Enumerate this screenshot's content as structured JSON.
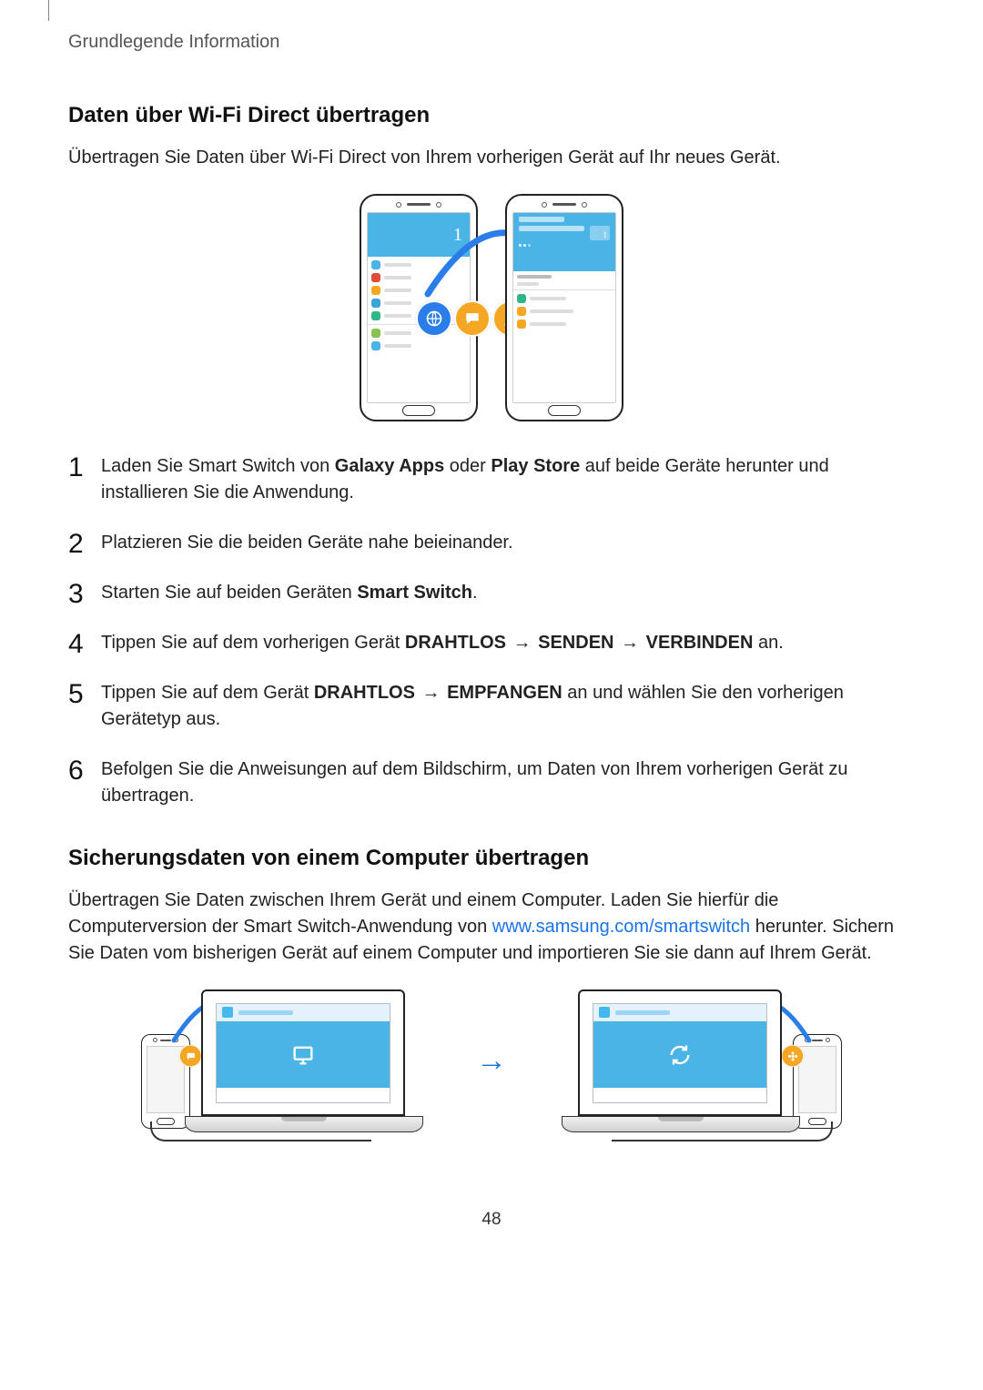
{
  "breadcrumb": "Grundlegende Information",
  "section1": {
    "title": "Daten über Wi-Fi Direct übertragen",
    "lead": "Übertragen Sie Daten über Wi-Fi Direct von Ihrem vorherigen Gerät auf Ihr neues Gerät."
  },
  "figure1": {
    "left_phone_number": "1",
    "right_phone_number": "1"
  },
  "steps": [
    {
      "prefix": "Laden Sie Smart Switch von ",
      "bold1": "Galaxy Apps",
      "mid1": " oder ",
      "bold2": "Play Store",
      "suffix": " auf beide Geräte herunter und installieren Sie die Anwendung."
    },
    {
      "text": "Platzieren Sie die beiden Geräte nahe beieinander."
    },
    {
      "prefix": "Starten Sie auf beiden Geräten ",
      "bold1": "Smart Switch",
      "suffix": "."
    },
    {
      "prefix": "Tippen Sie auf dem vorherigen Gerät ",
      "bold1": "DRAHTLOS",
      "arrow": " → ",
      "bold2": "SENDEN",
      "arrow2": " → ",
      "bold3": "VERBINDEN",
      "suffix": " an."
    },
    {
      "prefix": "Tippen Sie auf dem Gerät ",
      "bold1": "DRAHTLOS",
      "arrow": " → ",
      "bold2": "EMPFANGEN",
      "suffix": " an und wählen Sie den vorherigen Gerätetyp aus."
    },
    {
      "text": "Befolgen Sie die Anweisungen auf dem Bildschirm, um Daten von Ihrem vorherigen Gerät zu übertragen."
    }
  ],
  "section2": {
    "title": "Sicherungsdaten von einem Computer übertragen",
    "lead_pre": "Übertragen Sie Daten zwischen Ihrem Gerät und einem Computer. Laden Sie hierfür die Computerversion der Smart Switch-Anwendung von ",
    "link_text": "www.samsung.com/smartswitch",
    "link_href": "http://www.samsung.com/smartswitch",
    "lead_post": " herunter. Sichern Sie Daten vom bisherigen Gerät auf einem Computer und importieren Sie sie dann auf Ihrem Gerät."
  },
  "mid_arrow": "→",
  "page_number": "48"
}
